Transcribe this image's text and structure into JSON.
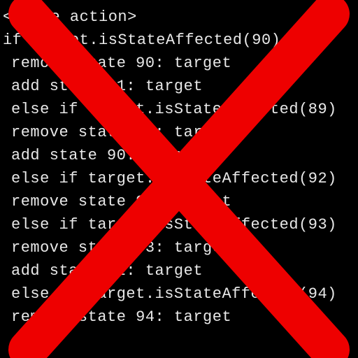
{
  "code": {
    "lines": [
      {
        "text": "<whole action>",
        "indent": 0
      },
      {
        "text": "if target.isStateAffected(90)",
        "indent": 0
      },
      {
        "text": "remove state 90: target",
        "indent": 1
      },
      {
        "text": "add state 91: target",
        "indent": 1
      },
      {
        "text": "else if target.isStateAffected(89)",
        "indent": 1
      },
      {
        "text": "remove state 89: target",
        "indent": 1
      },
      {
        "text": "add state 90: target",
        "indent": 1
      },
      {
        "text": "else if target.isStateAffected(92)",
        "indent": 1
      },
      {
        "text": "remove state 92: target",
        "indent": 1
      },
      {
        "text": "else if target.isStateAffected(93)",
        "indent": 1
      },
      {
        "text": "remove state 93: target",
        "indent": 1
      },
      {
        "text": "add state 92: target",
        "indent": 1
      },
      {
        "text": "else if target.isStateAffected(94)",
        "indent": 1
      },
      {
        "text": "remove state 94: target",
        "indent": 1
      }
    ]
  },
  "overlay": {
    "type": "red-x",
    "color": "#ee0000"
  }
}
